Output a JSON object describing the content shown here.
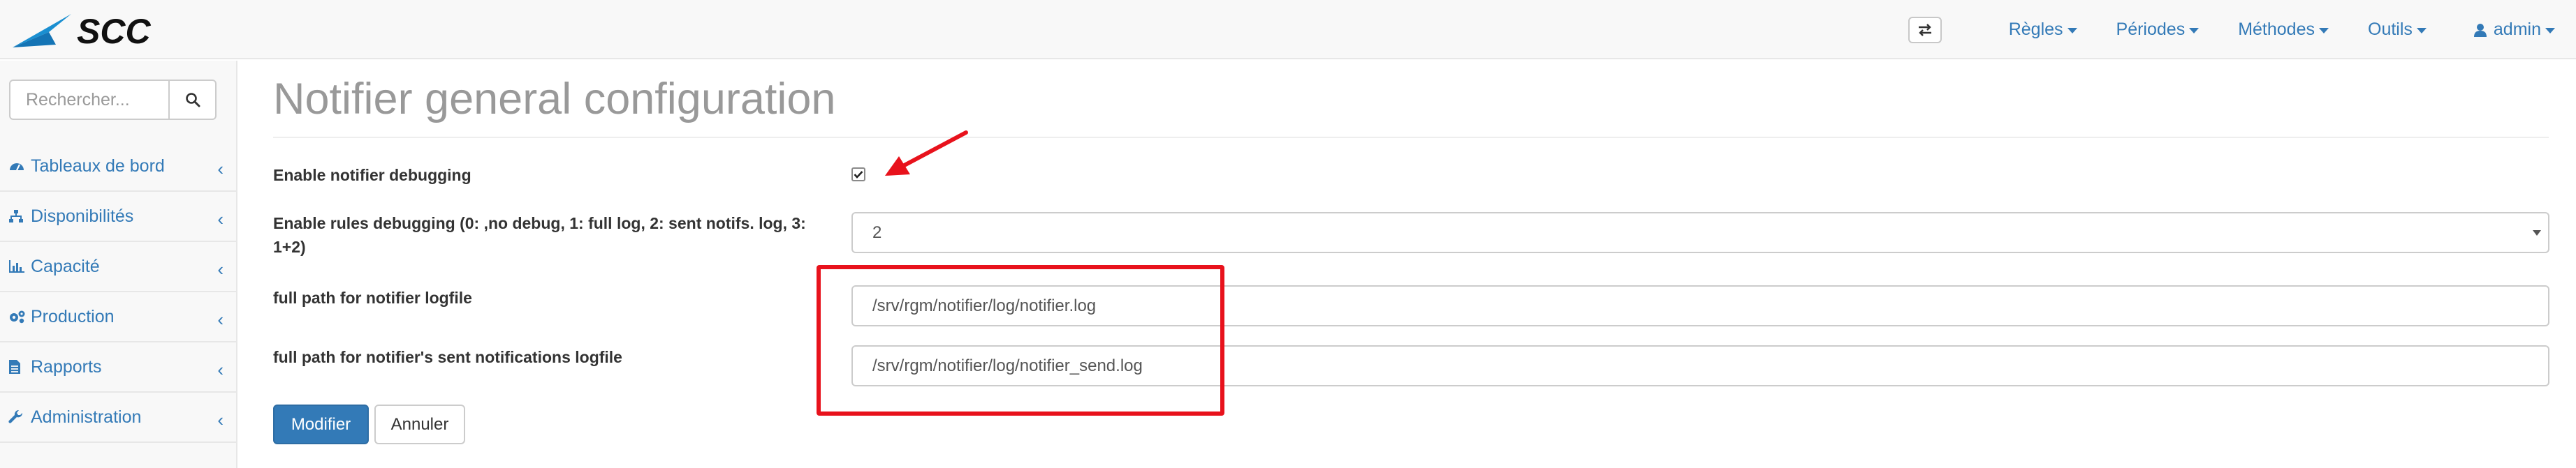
{
  "brand": {
    "logo_text": "SCC"
  },
  "navbar": {
    "items": [
      {
        "label": "Règles"
      },
      {
        "label": "Périodes"
      },
      {
        "label": "Méthodes"
      },
      {
        "label": "Outils"
      }
    ],
    "user": {
      "label": "admin"
    }
  },
  "sidebar": {
    "search_placeholder": "Rechercher...",
    "items": [
      {
        "label": "Tableaux de bord",
        "icon": "dashboard-icon"
      },
      {
        "label": "Disponibilités",
        "icon": "sitemap-icon"
      },
      {
        "label": "Capacité",
        "icon": "bar-chart-icon"
      },
      {
        "label": "Production",
        "icon": "gears-icon"
      },
      {
        "label": "Rapports",
        "icon": "file-text-icon"
      },
      {
        "label": "Administration",
        "icon": "wrench-icon"
      }
    ]
  },
  "main": {
    "title": "Notifier general configuration",
    "fields": {
      "debug_label": "Enable notifier debugging",
      "debug_checked": true,
      "rules_debug_label_line1": "Enable rules debugging (0: ,no debug, 1: full log, 2: sent notifs. log, 3:",
      "rules_debug_label_line2": "1+2)",
      "rules_debug_value": "2",
      "logfile_label": "full path for notifier logfile",
      "logfile_value": "/srv/rgm/notifier/log/notifier.log",
      "sent_logfile_label": "full path for notifier's sent notifications logfile",
      "sent_logfile_value": "/srv/rgm/notifier/log/notifier_send.log"
    },
    "buttons": {
      "submit": "Modifier",
      "cancel": "Annuler"
    }
  },
  "colors": {
    "link": "#337ab7",
    "primary": "#337ab7",
    "annotation": "#e8121c",
    "title": "#999999"
  }
}
